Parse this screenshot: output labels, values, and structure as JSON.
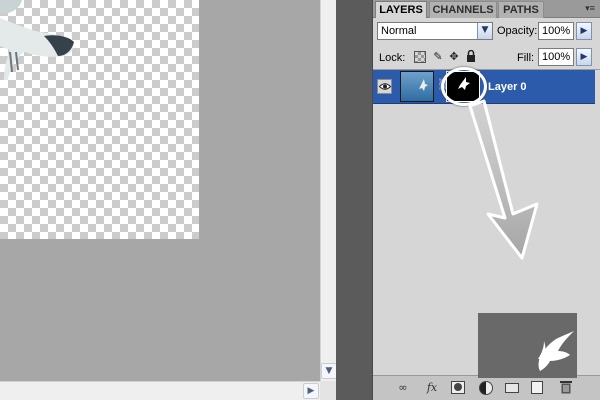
{
  "panel": {
    "tabs": [
      {
        "label": "LAYERS",
        "active": true
      },
      {
        "label": "CHANNELS",
        "active": false
      },
      {
        "label": "PATHS",
        "active": false
      }
    ],
    "menu_icon": "panel-menu-icon",
    "blend_mode": "Normal",
    "opacity_label": "Opacity:",
    "opacity_value": "100%",
    "lock_label": "Lock:",
    "fill_label": "Fill:",
    "fill_value": "100%",
    "lock_icons": [
      "lock-transparency-icon",
      "lock-brush-icon",
      "lock-move-icon",
      "lock-all-icon"
    ],
    "footer_icons": [
      "link-layers-icon",
      "fx-icon",
      "add-mask-icon",
      "adjustment-layer-icon",
      "new-group-icon",
      "new-layer-icon",
      "delete-layer-icon"
    ]
  },
  "layers": [
    {
      "name": "Layer 0",
      "visible": true,
      "selected": true,
      "has_mask": true
    }
  ],
  "colors": {
    "selection": "#2d5bac",
    "panel_bg": "#d6d6d6",
    "canvas_bg": "#a7a7a7",
    "annotation": "#ffffff"
  }
}
